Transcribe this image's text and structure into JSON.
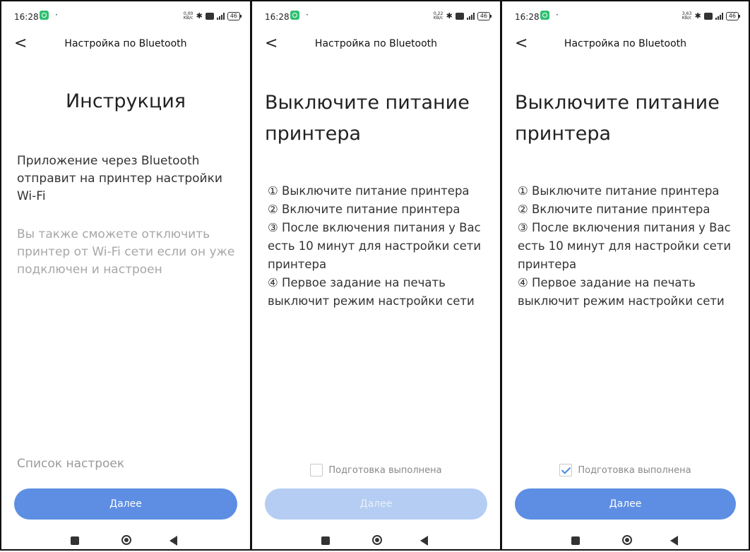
{
  "status": {
    "time": "16:28",
    "dot": "·",
    "net_speeds": [
      "0,00",
      "0,22",
      "3,63"
    ],
    "net_unit": "KB/c",
    "battery": "46"
  },
  "nav": {
    "title": "Настройка по Bluetooth",
    "back_glyph": "<"
  },
  "screen1": {
    "heading": "Инструкция",
    "paragraph1": "Приложение через Bluetooth отправит на принтер настройки Wi-Fi",
    "paragraph2": "Вы также сможете отключить принтер от Wi-Fi сети если он уже подключен и настроен",
    "settings_link": "Список настроек",
    "button": "Далее"
  },
  "screen2": {
    "heading": "Выключите питание принтера",
    "steps": [
      "① Выключите питание принтера",
      "② Включите питание принтера",
      "③ После включения питания у Вас есть 10 минут для настройки сети принтера",
      "④ Первое задание на печать выключит режим настройки сети"
    ],
    "checkbox_label": "Подготовка выполнена",
    "checked": false,
    "button": "Далее"
  },
  "screen3": {
    "heading": "Выключите питание принтера",
    "steps": [
      "① Выключите питание принтера",
      "② Включите питание принтера",
      "③ После включения питания у Вас есть 10 минут для настройки сети принтера",
      "④ Первое задание на печать выключит режим настройки сети"
    ],
    "checkbox_label": "Подготовка выполнена",
    "checked": true,
    "button": "Далее"
  },
  "colors": {
    "accent": "#5d8ee3",
    "accent_disabled": "#b5cdf2",
    "check": "#4a8be0",
    "notif": "#2fbf71"
  }
}
